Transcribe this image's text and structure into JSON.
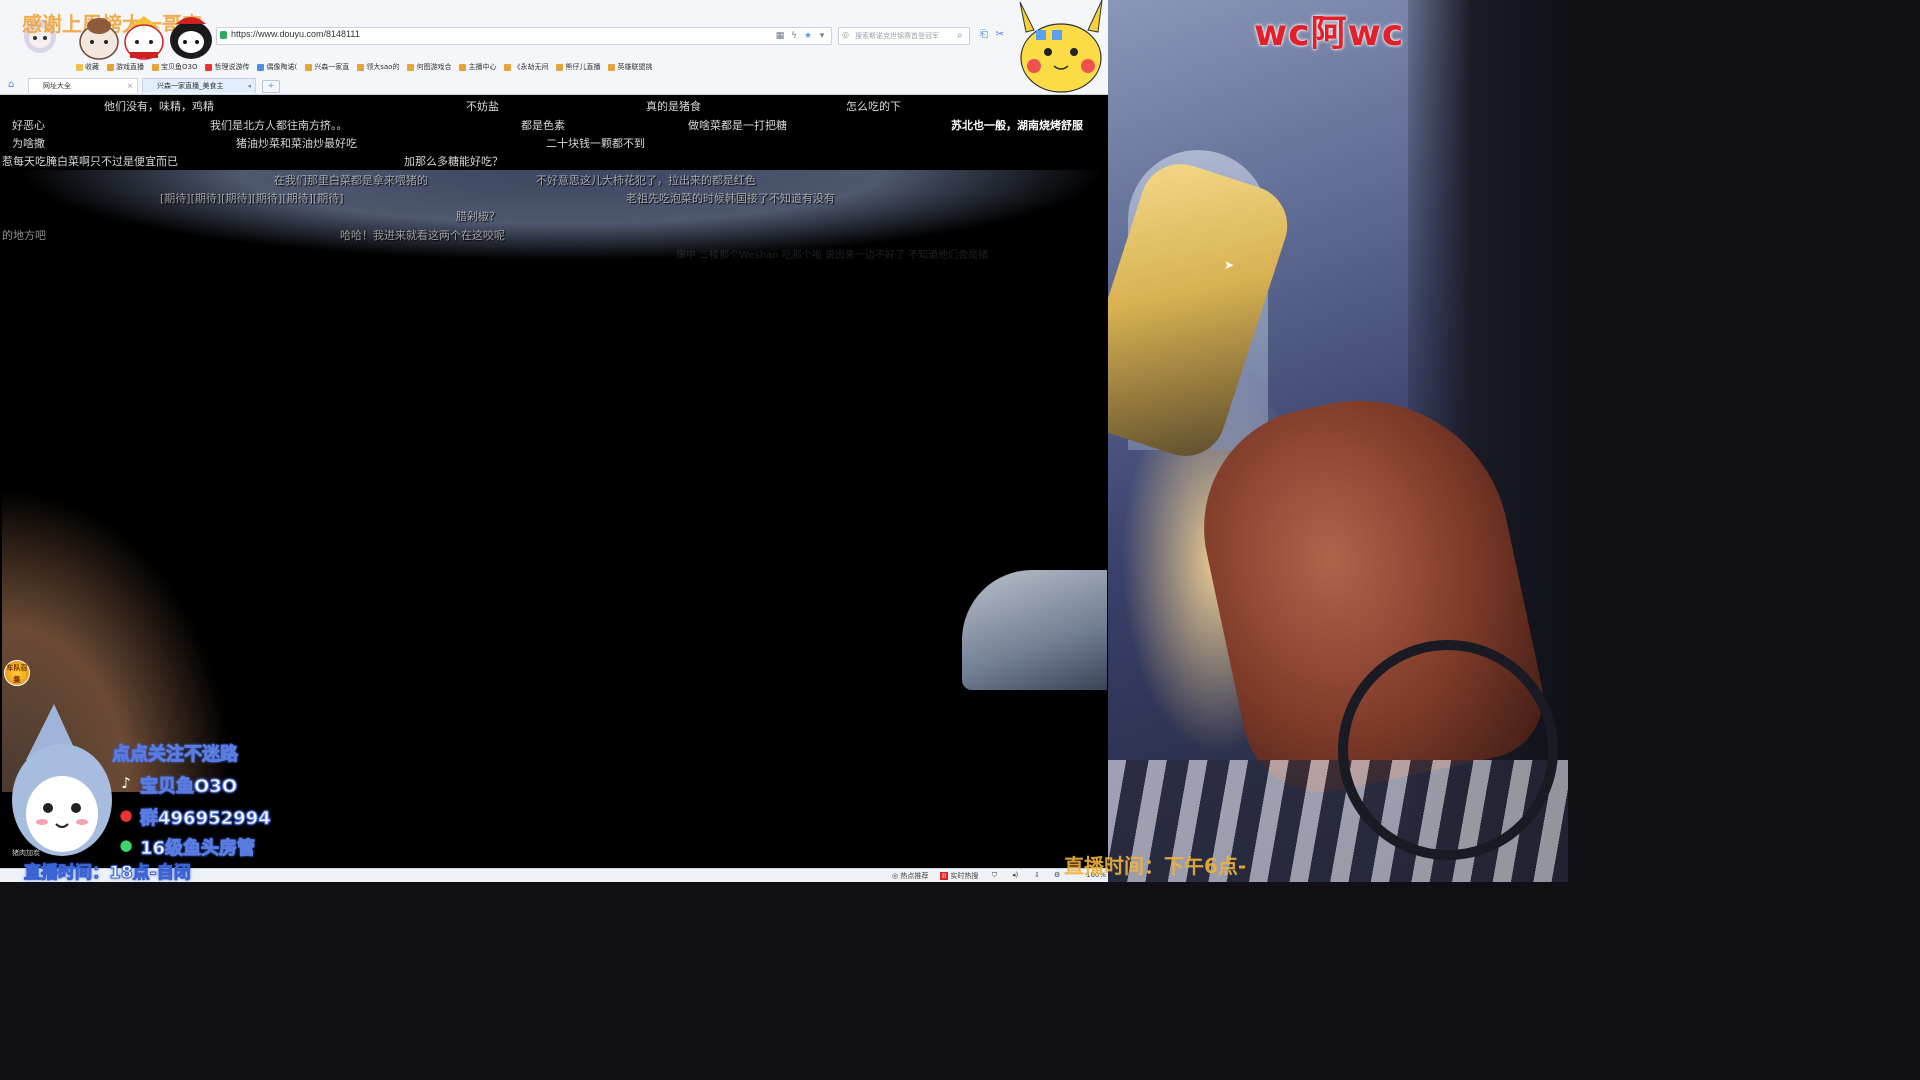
{
  "browser": {
    "url": "https://www.douyu.com/8148111",
    "search_placeholder": "搜索斯诺克世锦赛首登冠军",
    "bookmarks": [
      {
        "label": "收藏"
      },
      {
        "label": "游戏直播"
      },
      {
        "label": "宝贝鱼O3O"
      },
      {
        "label": "哲理说游传"
      },
      {
        "label": "偶像陶诺("
      },
      {
        "label": "兴森一家直"
      },
      {
        "label": "领大sao的"
      },
      {
        "label": "何图游戏合"
      },
      {
        "label": "主播中心"
      },
      {
        "label": "《永劫无间"
      },
      {
        "label": "熊仔儿直播"
      },
      {
        "label": "英雄联盟挑"
      }
    ],
    "tabs": [
      {
        "label": "网址大全",
        "active": false
      },
      {
        "label": "兴森一家直播_美食主",
        "active": true
      }
    ],
    "status": [
      {
        "label": "热点推荐"
      },
      {
        "label": "实时热搜"
      }
    ],
    "zoom": "100%"
  },
  "overlay": {
    "thanks": "感谢上周榜大一哥宝",
    "promo": [
      {
        "icon": "heart-icon",
        "text": "点点关注不迷路"
      },
      {
        "icon": "douyin-icon",
        "text": "宝贝鱼O3O"
      },
      {
        "icon": "qq-icon",
        "text": "群496952994"
      },
      {
        "icon": "wechat-icon",
        "text": "16级鱼头房管"
      }
    ],
    "live_time": "直播时间：18点-自闭",
    "badge": "车队召集",
    "small_text": "猪肉加炭"
  },
  "danmaku": [
    {
      "text": "他们没有，味精，鸡精",
      "style": ""
    },
    {
      "text": "不妨盐",
      "style": ""
    },
    {
      "text": "真的是猪食",
      "style": ""
    },
    {
      "text": "怎么吃的下",
      "style": ""
    },
    {
      "text": "好恶心",
      "style": ""
    },
    {
      "text": "我们是北方人都往南方挤。。",
      "style": ""
    },
    {
      "text": "都是色素",
      "style": ""
    },
    {
      "text": "做啥菜都是一打把糖",
      "style": ""
    },
    {
      "text": "苏北也一般，湖南烧烤舒服",
      "style": "bold"
    },
    {
      "text": "为啥撒",
      "style": ""
    },
    {
      "text": "猪油炒菜和菜油炒最好吃",
      "style": ""
    },
    {
      "text": "二十块钱一颗都不到",
      "style": ""
    },
    {
      "text": "惹每天吃腌白菜啊只不过是便宜而已",
      "style": ""
    },
    {
      "text": "加那么多糖能好吃？",
      "style": ""
    },
    {
      "text": "在我们那里白菜都是拿来喂猪的",
      "style": "faint"
    },
    {
      "text": "不好意思这儿大柿花犯了，拉出来的都是红色",
      "style": "faint"
    },
    {
      "text": "[期待][期待][期待][期待][期待][期待]",
      "style": "faint"
    },
    {
      "text": "老祖先吃泡菜的时候韩国接了不知道有没有",
      "style": "faint"
    },
    {
      "text": "腊剁椒？",
      "style": "faint"
    },
    {
      "text": "的地方吧",
      "style": "faint"
    },
    {
      "text": "哈哈！我进来就看这两个在这咬呢",
      "style": "faint"
    },
    {
      "text": "康中 二楼那个Weshan 吃那个啦 说出来一边不好了 不知道他们会是猪",
      "style": "dark"
    }
  ],
  "art": {
    "title": "wc阿wc",
    "bottom_text": "直播时间：下午6点-"
  }
}
